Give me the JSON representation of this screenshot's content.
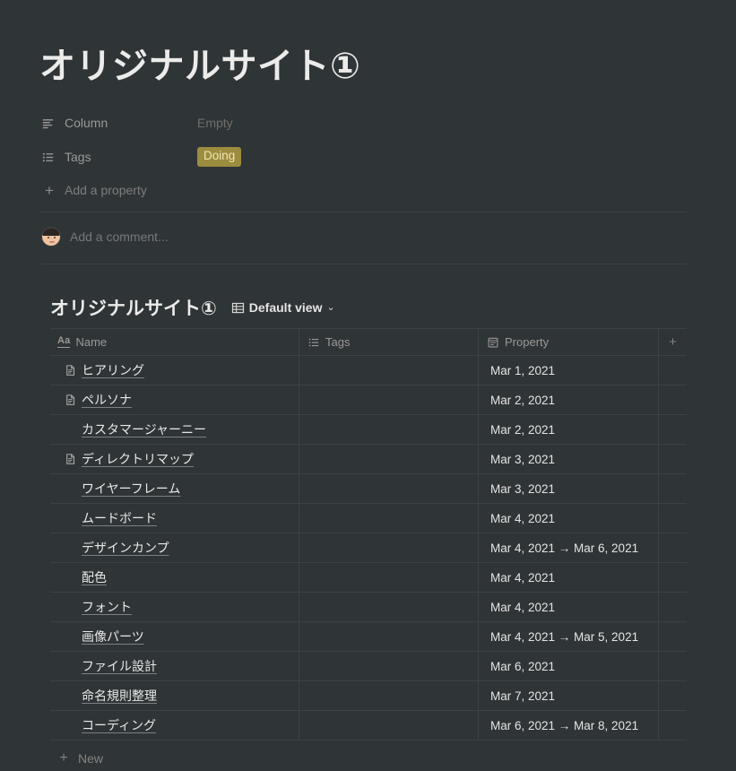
{
  "page": {
    "title": "オリジナルサイト①"
  },
  "properties": [
    {
      "icon": "text-align-icon",
      "label": "Column",
      "value": "Empty",
      "value_type": "empty"
    },
    {
      "icon": "bullet-list-icon",
      "label": "Tags",
      "value": "Doing",
      "value_type": "badge"
    }
  ],
  "add_property_label": "Add a property",
  "comment": {
    "placeholder": "Add a comment...",
    "avatar_name": "user-avatar"
  },
  "database": {
    "title": "オリジナルサイト①",
    "view_icon": "table-icon",
    "view_label": "Default view",
    "chevron": "⌄",
    "columns": [
      {
        "icon": "aa-icon",
        "label": "Name"
      },
      {
        "icon": "bullet-list-icon",
        "label": "Tags"
      },
      {
        "icon": "calendar-icon",
        "label": "Property"
      }
    ],
    "add_column_label": "+",
    "rows": [
      {
        "name": "ヒアリング",
        "has_icon": true,
        "tags": "",
        "property": "Mar 1, 2021"
      },
      {
        "name": "ペルソナ",
        "has_icon": true,
        "tags": "",
        "property": "Mar 2, 2021"
      },
      {
        "name": "カスタマージャーニー",
        "has_icon": false,
        "tags": "",
        "property": "Mar 2, 2021"
      },
      {
        "name": "ディレクトリマップ",
        "has_icon": true,
        "tags": "",
        "property": "Mar 3, 2021"
      },
      {
        "name": "ワイヤーフレーム",
        "has_icon": false,
        "tags": "",
        "property": "Mar 3, 2021"
      },
      {
        "name": "ムードボード",
        "has_icon": false,
        "tags": "",
        "property": "Mar 4, 2021"
      },
      {
        "name": "デザインカンプ",
        "has_icon": false,
        "tags": "",
        "property": "Mar 4, 2021 → Mar 6, 2021"
      },
      {
        "name": "配色",
        "has_icon": false,
        "tags": "",
        "property": "Mar 4, 2021"
      },
      {
        "name": "フォント",
        "has_icon": false,
        "tags": "",
        "property": "Mar 4, 2021"
      },
      {
        "name": "画像パーツ",
        "has_icon": false,
        "tags": "",
        "property": "Mar 4, 2021 → Mar 5, 2021"
      },
      {
        "name": "ファイル設計",
        "has_icon": false,
        "tags": "",
        "property": "Mar 6, 2021"
      },
      {
        "name": "命名規則整理",
        "has_icon": false,
        "tags": "",
        "property": "Mar 7, 2021"
      },
      {
        "name": "コーディング",
        "has_icon": false,
        "tags": "",
        "property": "Mar 6, 2021 → Mar 8, 2021"
      }
    ],
    "new_row_label": "New"
  },
  "colors": {
    "background": "#2f3437",
    "text_primary": "#e8e8e6",
    "text_muted": "#9b9a97",
    "border": "#3c4245",
    "badge_bg": "#9c8c3f",
    "badge_text": "#efe8b0"
  }
}
